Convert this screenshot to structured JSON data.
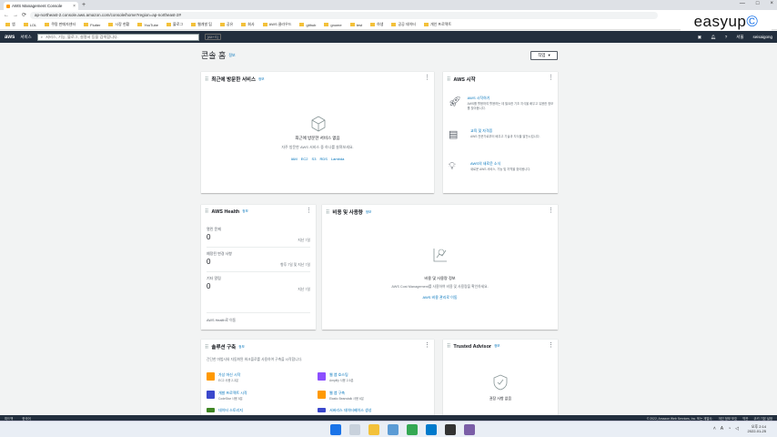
{
  "browser": {
    "tab_title": "AWS Management Console",
    "url": "ap-northeast-2.console.aws.amazon.com/console/home?region=ap-northeast-2#",
    "bookmarks": [
      "앱",
      "LOL",
      "쿠팡 판매자센터",
      "Flutter",
      "시장 현황",
      "YouTube",
      "블로그",
      "웹개발 팁",
      "공유",
      "회사",
      "AWS 클라우드",
      "github",
      "gnome",
      "test",
      "하생",
      "공공 데이터",
      "개인 프로젝트"
    ]
  },
  "watermark": {
    "text": "easyup",
    "accent": "©"
  },
  "aws_nav": {
    "logo": "aws",
    "services": "서비스",
    "search_placeholder": "서비스, 기능, 블로그, 설명서 등을 검색합니다.",
    "search_shortcut": "[Alt+S]",
    "region": "서울",
    "account": "seisaigong"
  },
  "page": {
    "title": "콘솔 홈",
    "info": "정보",
    "layout_button": "작업"
  },
  "recent": {
    "title": "최근에 방문한 서비스",
    "info": "정보",
    "empty_title": "최근에 방문한 서비스 없음",
    "empty_desc": "자주 방문한 AWS 서비스 중 하나를 살펴보세요.",
    "links": [
      "IAM",
      "EC2",
      "S3",
      "RDS",
      "Lambda"
    ]
  },
  "start": {
    "title": "AWS 시작",
    "items": [
      {
        "title": "AWS 시작하기",
        "desc": "AWS를 활용하여 활용하는 데 필요한 기초 지식을 배우고 유용한 정보를 찾아봅니다."
      },
      {
        "title": "교육 및 자격증",
        "desc": "AWS 전문가로부터 배우고 기술과 지식을 발전시킵니다."
      },
      {
        "title": "AWS의 새로운 소식",
        "desc": "새로운 AWS 서비스, 기능 및 지역을 찾아봅니다."
      }
    ]
  },
  "health": {
    "title": "AWS Health",
    "info": "정보",
    "stats": [
      {
        "label": "열린 문제",
        "value": "0",
        "side": "지난 7일"
      },
      {
        "label": "예정된 변경 사항",
        "value": "0",
        "side": "향후 7일 및 지난 7일"
      },
      {
        "label": "기타 알림",
        "value": "0",
        "side": "지난 7일"
      }
    ],
    "link": "AWS Health로 이동"
  },
  "cost": {
    "title": "비용 및 사용량",
    "info": "정보",
    "empty_title": "비용 및 사용량 정보",
    "empty_desc": "AWS Cost Management를 사용하여 비용 및 사용량을 확인하세요.",
    "link": "AWS 비용 관리로 이동"
  },
  "solutions": {
    "title": "솔루션 구축",
    "info": "정보",
    "desc": "간단한 마법사와 자동화된 워크플로를 사용하여 구축을 시작합니다.",
    "items": [
      {
        "title": "가상 머신 시작",
        "desc": "EC2 사용 2-3분"
      },
      {
        "title": "웹 앱 호스팅",
        "desc": "Amplify 사용 2-5분"
      },
      {
        "title": "개발 프로젝트 시작",
        "desc": "CodeStar 사용 5분"
      },
      {
        "title": "웹 앱 구축",
        "desc": "Elastic Beanstalk 사용 6분"
      },
      {
        "title": "데이터 스토리지",
        "desc": ""
      },
      {
        "title": "서버리스 데이터베이스 생성",
        "desc": ""
      }
    ]
  },
  "trusted": {
    "title": "Trusted Advisor",
    "info": "정보",
    "empty": "권장 사항 없음"
  },
  "footer": {
    "left": [
      "피드백",
      "한국어"
    ],
    "copyright": "© 2022, Amazon Web Services, Inc. 또는 계열사.",
    "right": [
      "개인 정보 보호",
      "약관",
      "쿠키 기본 설정"
    ]
  },
  "taskbar": {
    "time": "오후 2:14",
    "date": "2022-01-25",
    "lang": "A",
    "icons": [
      "windows-icon",
      "search-icon",
      "file-explorer-icon",
      "store-icon",
      "chrome-icon",
      "vscode-icon",
      "terminal-icon",
      "app-icon"
    ]
  },
  "colors": {
    "aws_nav": "#232f3e",
    "link": "#0073bb",
    "brand_orange": "#ff9900"
  }
}
